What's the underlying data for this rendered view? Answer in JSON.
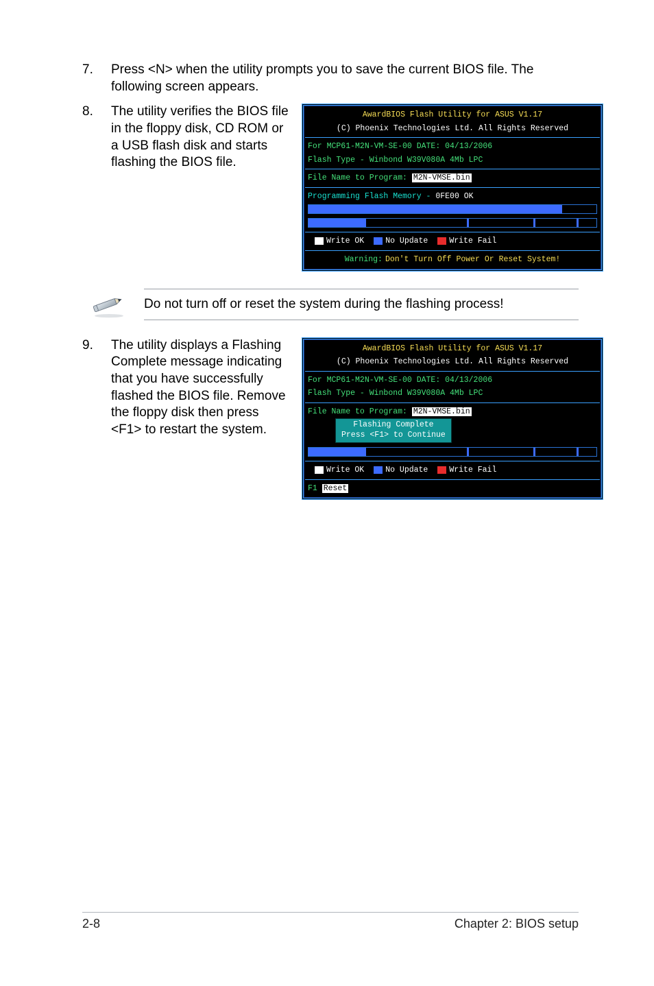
{
  "steps": {
    "s7": {
      "num": "7.",
      "text": "Press <N> when the utility prompts you to save the current BIOS file. The following screen appears."
    },
    "s8": {
      "num": "8.",
      "text": "The utility verifies the BIOS file in the floppy disk, CD ROM or a USB flash disk and starts flashing the BIOS file."
    },
    "s9": {
      "num": "9.",
      "text": "The utility displays a Flashing Complete message indicating that you have successfully flashed the BIOS file. Remove the floppy disk then press <F1> to restart the system."
    }
  },
  "note_text": "Do not turn off or reset the system during the flashing process!",
  "term_common": {
    "title": "AwardBIOS Flash Utility for ASUS V1.17",
    "copyright": "(C) Phoenix Technologies Ltd. All Rights Reserved",
    "for_line": "For MCP61-M2N-VM-SE-00     DATE: 04/13/2006",
    "flash_type": "Flash Type - Winbond W39V080A 4Mb LPC",
    "file_label": "File Name to Program: ",
    "file_name": "M2N-VMSE.bin",
    "legend": {
      "write_ok": "Write OK",
      "no_update": "No Update",
      "write_fail": "Write Fail"
    }
  },
  "term1": {
    "prog_line": "Programming Flash Memory - ",
    "prog_val": "0FE00 OK",
    "warning": "Warning: Don't Turn Off Power Or Reset System!"
  },
  "term2": {
    "flash_complete": "Flashing Complete",
    "press_f1": "Press <F1> to Continue",
    "f1": "F1 ",
    "reset": "Reset"
  },
  "footer": {
    "left": "2-8",
    "right": "Chapter 2: BIOS setup"
  }
}
